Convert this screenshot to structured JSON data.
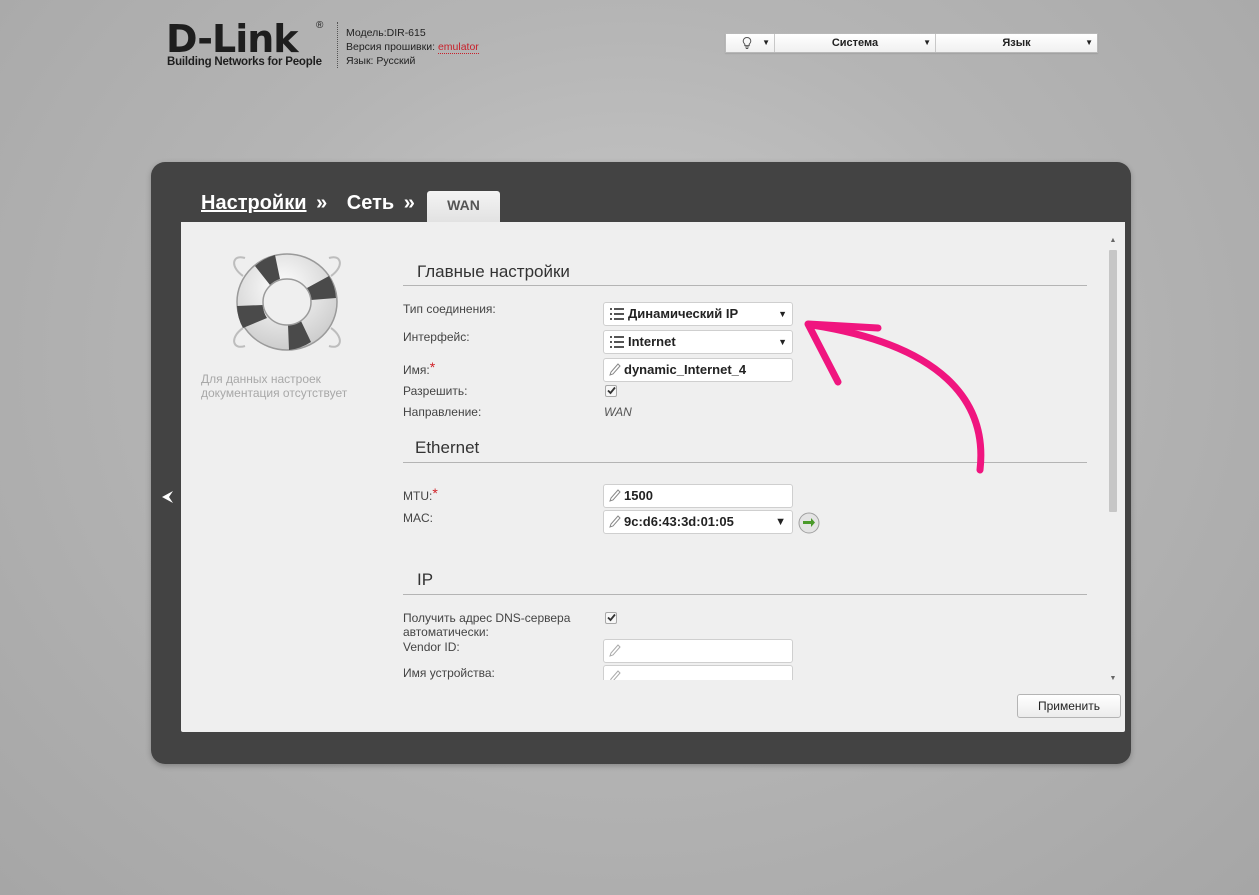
{
  "header": {
    "logo_text": "D-Link",
    "logo_reg": "®",
    "logo_tagline": "Building Networks for People",
    "model": "Модель:DIR-615",
    "firmware_label": "Версия прошивки:",
    "firmware_value": "emulator",
    "language": "Язык: Русский"
  },
  "topbar": {
    "bulb_icon": "lightbulb-icon",
    "system_label": "Система",
    "language_label": "Язык"
  },
  "breadcrumb": {
    "settings": "Настройки",
    "network": "Сеть",
    "sep": "»",
    "active_tab": "WAN"
  },
  "help": {
    "icon": "lifebuoy-icon",
    "text": "Для данных настроек документация отсутствует"
  },
  "sections": {
    "main": "Главные настройки",
    "ethernet": "Ethernet",
    "ip": "IP"
  },
  "form": {
    "connection_type_label": "Тип соединения:",
    "connection_type_value": "Динамический IP",
    "interface_label": "Интерфейс:",
    "interface_value": "Internet",
    "name_label": "Имя:",
    "name_value": "dynamic_Internet_4",
    "enable_label": "Разрешить:",
    "enable_checked": true,
    "direction_label": "Направление:",
    "direction_value": "WAN",
    "mtu_label": "MTU:",
    "mtu_value": "1500",
    "mac_label": "MAC:",
    "mac_value": "9c:d6:43:3d:01:05",
    "dns_auto_label": "Получить адрес DNS-сервера автоматически:",
    "dns_auto_checked": true,
    "vendor_id_label": "Vendor ID:",
    "vendor_id_value": "",
    "device_name_label": "Имя устройства:",
    "device_name_value": "",
    "required_mark": "*"
  },
  "buttons": {
    "apply": "Применить"
  },
  "colors": {
    "panel_bg": "#434343",
    "content_bg": "#efefef",
    "accent_red": "#c8202a",
    "annotation_pink": "#f0157f",
    "go_green": "#4a9a2a"
  }
}
